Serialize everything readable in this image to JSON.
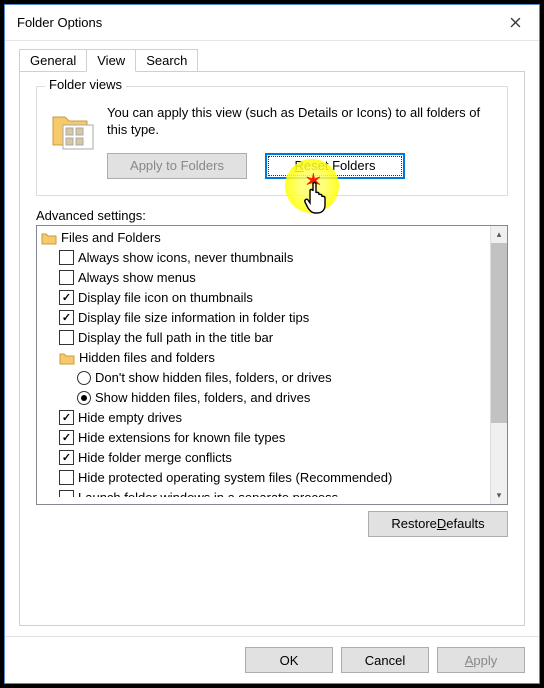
{
  "window": {
    "title": "Folder Options"
  },
  "tabs": {
    "general": "General",
    "view": "View",
    "search": "Search"
  },
  "folderViews": {
    "groupLabel": "Folder views",
    "description": "You can apply this view (such as Details or Icons) to all folders of this type.",
    "applyBtn": "Apply to Folders",
    "resetBtn": "Reset Folders"
  },
  "advanced": {
    "label": "Advanced settings:",
    "root": "Files and Folders",
    "items": [
      {
        "type": "checkbox",
        "checked": false,
        "label": "Always show icons, never thumbnails"
      },
      {
        "type": "checkbox",
        "checked": false,
        "label": "Always show menus"
      },
      {
        "type": "checkbox",
        "checked": true,
        "label": "Display file icon on thumbnails"
      },
      {
        "type": "checkbox",
        "checked": true,
        "label": "Display file size information in folder tips"
      },
      {
        "type": "checkbox",
        "checked": false,
        "label": "Display the full path in the title bar"
      },
      {
        "type": "folder",
        "label": "Hidden files and folders"
      },
      {
        "type": "radio",
        "selected": false,
        "label": "Don't show hidden files, folders, or drives"
      },
      {
        "type": "radio",
        "selected": true,
        "label": "Show hidden files, folders, and drives"
      },
      {
        "type": "checkbox",
        "checked": true,
        "label": "Hide empty drives"
      },
      {
        "type": "checkbox",
        "checked": true,
        "label": "Hide extensions for known file types"
      },
      {
        "type": "checkbox",
        "checked": true,
        "label": "Hide folder merge conflicts"
      },
      {
        "type": "checkbox",
        "checked": false,
        "label": "Hide protected operating system files (Recommended)"
      },
      {
        "type": "checkbox",
        "checked": false,
        "label": "Launch folder windows in a separate process"
      }
    ]
  },
  "buttons": {
    "restoreDefaults": "Restore Defaults",
    "ok": "OK",
    "cancel": "Cancel",
    "apply": "Apply"
  }
}
